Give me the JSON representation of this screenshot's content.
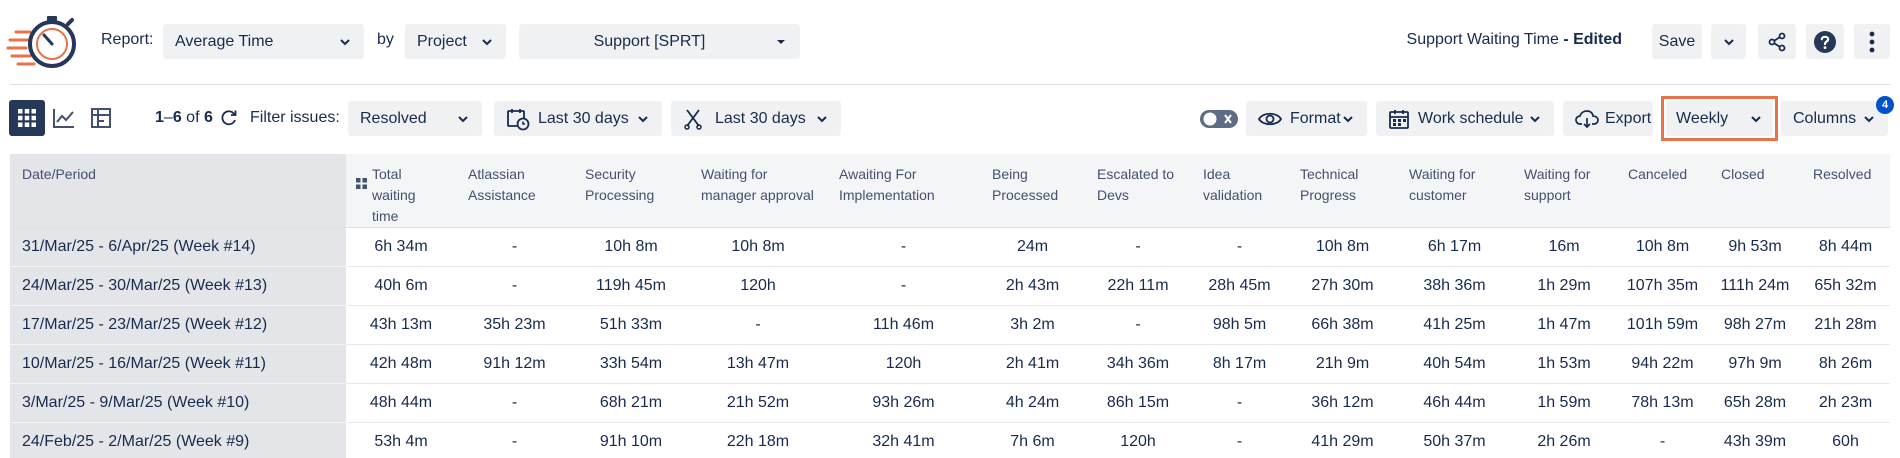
{
  "header": {
    "report_label": "Report:",
    "report_value": "Average Time",
    "by_label": "by",
    "by_value": "Project",
    "project_value": "Support [SPRT]",
    "report_name": "Support Waiting Time",
    "edited_suffix": " - Edited",
    "save_label": "Save"
  },
  "toolbar": {
    "range_start": "1",
    "range_sep": "–",
    "range_end": "6",
    "of_label": " of ",
    "total": "6",
    "filter_label": "Filter issues:",
    "filter_value": "Resolved",
    "date_filter_1": "Last 30 days",
    "date_filter_2": "Last 30 days",
    "format_label": "Format",
    "work_schedule_label": "Work schedule",
    "export_label": "Export",
    "period_value": "Weekly",
    "columns_label": "Columns",
    "columns_badge": "4"
  },
  "table": {
    "columns": [
      "Date/Period",
      "Total waiting time",
      "Atlassian Assistance",
      "Security Processing",
      "Waiting for manager approval",
      "Awaiting For Implementation",
      "Being Processed",
      "Escalated to Devs",
      "Idea validation",
      "Technical Progress",
      "Waiting for customer",
      "Waiting for support",
      "Canceled",
      "Closed",
      "Resolved"
    ],
    "rows": [
      [
        "31/Mar/25 - 6/Apr/25 (Week #14)",
        "6h 34m",
        "-",
        "10h 8m",
        "10h 8m",
        "-",
        "24m",
        "-",
        "-",
        "10h 8m",
        "6h 17m",
        "16m",
        "10h 8m",
        "9h 53m",
        "8h 44m"
      ],
      [
        "24/Mar/25 - 30/Mar/25 (Week #13)",
        "40h 6m",
        "-",
        "119h 45m",
        "120h",
        "-",
        "2h 43m",
        "22h 11m",
        "28h 45m",
        "27h 30m",
        "38h 36m",
        "1h 29m",
        "107h 35m",
        "111h 24m",
        "65h 32m"
      ],
      [
        "17/Mar/25 - 23/Mar/25 (Week #12)",
        "43h 13m",
        "35h 23m",
        "51h 33m",
        "-",
        "11h 46m",
        "3h 2m",
        "-",
        "98h 5m",
        "66h 38m",
        "41h 25m",
        "1h 47m",
        "101h 59m",
        "98h 27m",
        "21h 28m"
      ],
      [
        "10/Mar/25 - 16/Mar/25 (Week #11)",
        "42h 48m",
        "91h 12m",
        "33h 54m",
        "13h 47m",
        "120h",
        "2h 41m",
        "34h 36m",
        "8h 17m",
        "21h 9m",
        "40h 54m",
        "1h 53m",
        "94h 22m",
        "97h 9m",
        "8h 26m"
      ],
      [
        "3/Mar/25 - 9/Mar/25 (Week #10)",
        "48h 44m",
        "-",
        "68h 21m",
        "21h 52m",
        "93h 26m",
        "4h 24m",
        "86h 15m",
        "-",
        "36h 12m",
        "46h 44m",
        "1h 59m",
        "78h 13m",
        "65h 28m",
        "2h 23m"
      ],
      [
        "24/Feb/25 - 2/Mar/25 (Week #9)",
        "53h 4m",
        "-",
        "91h 10m",
        "22h 18m",
        "32h 41m",
        "7h 6m",
        "120h",
        "-",
        "41h 29m",
        "50h 37m",
        "2h 26m",
        "-",
        "43h 39m",
        "60h"
      ]
    ]
  },
  "icons": {
    "logo": "stopwatch-logo-icon",
    "share": "share-icon",
    "help": "help-icon",
    "more": "more-vertical-icon"
  },
  "colors": {
    "accent_highlight": "#e8724a",
    "logo_blue": "#253858",
    "badge": "#0052cc"
  }
}
